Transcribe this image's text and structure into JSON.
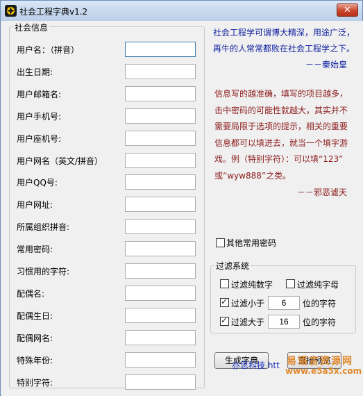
{
  "window": {
    "title": "社会工程字典v1.2",
    "close_glyph": "✕"
  },
  "social_info": {
    "legend": "社会信息",
    "fields": [
      {
        "label": "用户名：（拼音）",
        "value": ""
      },
      {
        "label": "出生日期:",
        "value": ""
      },
      {
        "label": "用户邮箱名:",
        "value": ""
      },
      {
        "label": "用户手机号:",
        "value": ""
      },
      {
        "label": "用户座机号:",
        "value": ""
      },
      {
        "label": "用户网名（英文/拼音）",
        "value": ""
      },
      {
        "label": "用户QQ号:",
        "value": ""
      },
      {
        "label": "用户网址:",
        "value": ""
      },
      {
        "label": "所属组织拼音:",
        "value": ""
      },
      {
        "label": "常用密码:",
        "value": ""
      },
      {
        "label": "习惯用的字符:",
        "value": ""
      },
      {
        "label": "配偶名:",
        "value": ""
      },
      {
        "label": "配偶生日:",
        "value": ""
      },
      {
        "label": "配偶网名:",
        "value": ""
      },
      {
        "label": "特殊年份:",
        "value": ""
      },
      {
        "label": "特别字符:",
        "value": ""
      }
    ]
  },
  "quote1": {
    "lines": [
      "社会工程学可谓博大精深，用途广泛，",
      "再牛的人常常都败在社会工程学之下。"
    ],
    "author": "－－秦始皇"
  },
  "quote2": {
    "lines": [
      "信息写的越准确，填写的项目越多，",
      "击中密码的可能性就越大，其实并不",
      "需要局限于选项的提示，相关的重要",
      "信息都可以填进去，就当一个填字游",
      "戏。例（特别字符）：可以填“123”",
      "或“wyw888”之类。"
    ],
    "author": "－－邪恶谑天"
  },
  "other_password": {
    "label": "其他常用密码",
    "checked": false
  },
  "filter": {
    "legend": "过滤系统",
    "pure_digits": {
      "label": "过滤纯数字",
      "checked": false
    },
    "pure_letters": {
      "label": "过滤纯字母",
      "checked": false
    },
    "less_than": {
      "label": "过滤小于",
      "checked": true,
      "value": "6",
      "suffix": "位的字符"
    },
    "greater_than": {
      "label": "过滤大于",
      "checked": true,
      "value": "16",
      "suffix": "位的字符"
    }
  },
  "buttons": {
    "generate": "生成字典",
    "preview": "直接预览"
  },
  "footer": {
    "brand": "亦思科技 htt",
    "watermark_cn": "易语言资源网",
    "watermark_url": "www.e5a5x.com"
  },
  "colors": {
    "quote_blue": "#1020a0",
    "quote_red": "#8b1a1a",
    "footer_blue": "#1a30c0",
    "watermark": "#e0882a"
  }
}
